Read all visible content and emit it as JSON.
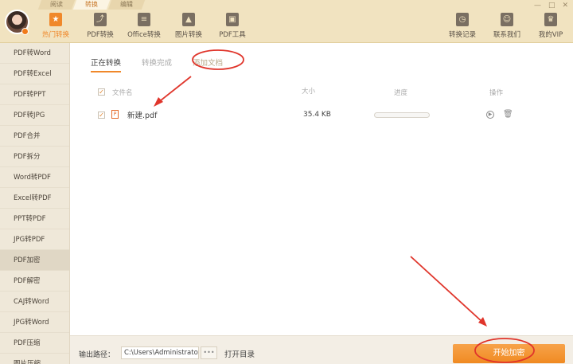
{
  "top_tabs": [
    {
      "label": "阅读"
    },
    {
      "label": "转换"
    },
    {
      "label": "编辑"
    }
  ],
  "window_controls": [
    "—",
    "□",
    "✕"
  ],
  "nav_left": [
    {
      "label": "热门转换",
      "icon": "star-icon"
    },
    {
      "label": "PDF转换",
      "icon": "pdf-icon"
    },
    {
      "label": "Office转换",
      "icon": "document-icon"
    },
    {
      "label": "图片转换",
      "icon": "image-icon"
    },
    {
      "label": "PDF工具",
      "icon": "toolbox-icon"
    }
  ],
  "nav_right": [
    {
      "label": "转换记录",
      "icon": "clock-icon"
    },
    {
      "label": "联系我们",
      "icon": "headset-icon"
    },
    {
      "label": "我的VIP",
      "icon": "crown-icon"
    }
  ],
  "sidebar": {
    "items": [
      "PDF转Word",
      "PDF转Excel",
      "PDF转PPT",
      "PDF转JPG",
      "PDF合并",
      "PDF拆分",
      "Word转PDF",
      "Excel转PDF",
      "PPT转PDF",
      "JPG转PDF",
      "PDF加密",
      "PDF解密",
      "CAJ转Word",
      "JPG转Word",
      "PDF压缩",
      "图片压缩"
    ],
    "active_index": 10
  },
  "subtabs": {
    "converting": "正在转换",
    "done": "转换完成",
    "add": "添加文档"
  },
  "table": {
    "headers": {
      "filename": "文件名",
      "size": "大小",
      "progress": "进度",
      "action": "操作"
    },
    "rows": [
      {
        "filename": "新建.pdf",
        "size": "35.4 KB",
        "progress": 0
      }
    ]
  },
  "bottom": {
    "output_label": "输出路径：",
    "output_path": "C:\\Users\\Administrator",
    "browse": "•••",
    "open_dir": "打开目录",
    "start_button": "开始加密"
  },
  "colors": {
    "accent": "#f0882a",
    "annotation": "#e0352b"
  }
}
